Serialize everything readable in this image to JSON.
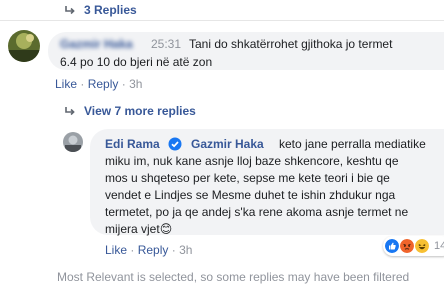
{
  "thread": {
    "replies_link": "3 Replies",
    "view_more_replies": "View 7 more replies"
  },
  "comment1": {
    "author": "Gazmir Haka",
    "timestamp": "25:31",
    "text_line1": "Tani do shkatërrohet gjithoka jo termet",
    "text_line2": "6.4 po 10 do bjeri në atë zon",
    "like": "Like",
    "reply": "Reply",
    "sep": "·",
    "age": "3h"
  },
  "comment2": {
    "author": "Edi Rama",
    "mention": "Gazmir Haka",
    "line1": "keto jane perralla mediatike",
    "line2": "miku im, nuk kane asnje lloj baze shkencore, keshtu qe",
    "line3": "mos u shqeteso per kete, sepse me kete teori i bie qe",
    "line4": "vendet e Lindjes se Mesme duhet te ishin zhdukur nga",
    "line5": "termetet, po ja qe andej s'ka rene akoma asnje termet ne",
    "line6": "mijera vjet",
    "emoji": "😊",
    "like": "Like",
    "reply": "Reply",
    "sep": "·",
    "age": "3h",
    "reaction_count": "14"
  },
  "footer": {
    "note": "Most Relevant is selected, so some replies may have been filtered"
  },
  "colors": {
    "link": "#385898",
    "bubble": "#f2f3f5",
    "muted": "#90949c",
    "like_blue": "#1877f2",
    "angry_orange": "#f0642b",
    "haha_yellow": "#f7c033"
  },
  "icons": {
    "reply_arrow": "reply-arrow-icon",
    "verified": "verified-badge-icon",
    "reactions": [
      "like-reaction-icon",
      "angry-reaction-icon",
      "haha-reaction-icon"
    ]
  }
}
